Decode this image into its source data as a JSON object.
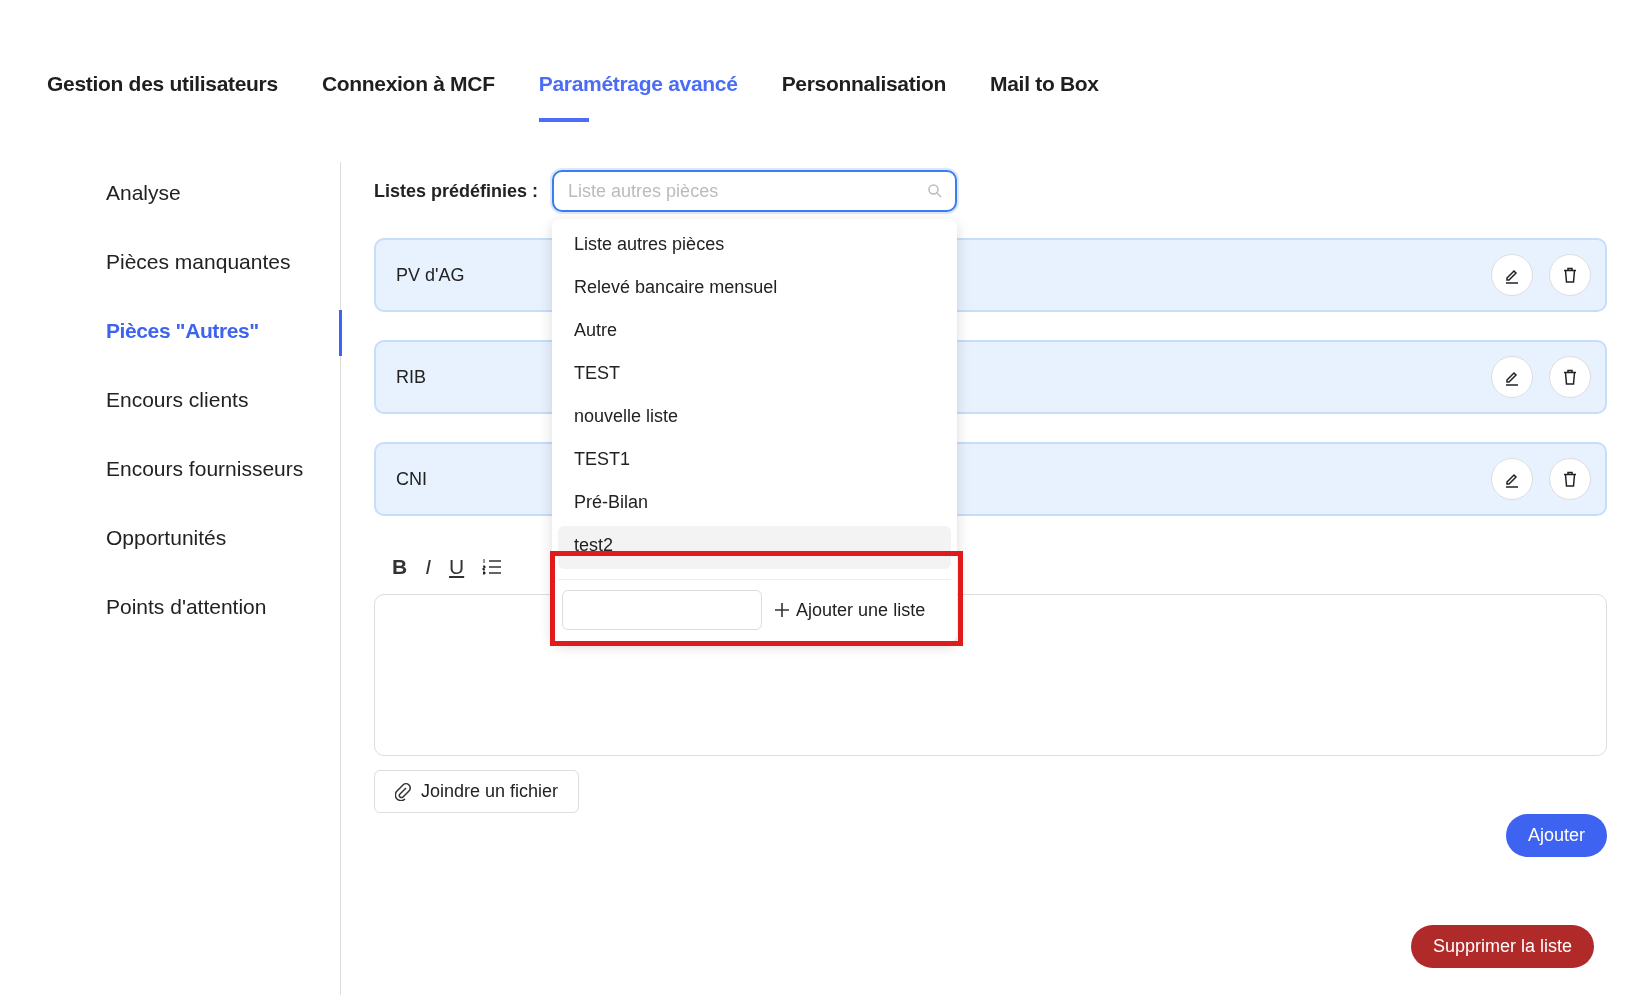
{
  "tabs": [
    {
      "label": "Gestion des utilisateurs",
      "selected": false
    },
    {
      "label": "Connexion à MCF",
      "selected": false
    },
    {
      "label": "Paramétrage avancé",
      "selected": true
    },
    {
      "label": "Personnalisation",
      "selected": false
    },
    {
      "label": "Mail to Box",
      "selected": false
    }
  ],
  "sidebar": {
    "items": [
      {
        "label": "Analyse",
        "selected": false
      },
      {
        "label": "Pièces manquantes",
        "selected": false
      },
      {
        "label": "Pièces \"Autres\"",
        "selected": true
      },
      {
        "label": "Encours clients",
        "selected": false
      },
      {
        "label": "Encours fournisseurs",
        "selected": false
      },
      {
        "label": "Opportunités",
        "selected": false
      },
      {
        "label": "Points d'attention",
        "selected": false
      }
    ]
  },
  "predefined_lists": {
    "label": "Listes prédéfinies :",
    "placeholder": "Liste autres pièces",
    "options": [
      {
        "label": "Liste autres pièces",
        "highlighted": false
      },
      {
        "label": "Relevé bancaire mensuel",
        "highlighted": false
      },
      {
        "label": "Autre",
        "highlighted": false
      },
      {
        "label": "TEST",
        "highlighted": false
      },
      {
        "label": "nouvelle liste",
        "highlighted": false
      },
      {
        "label": "TEST1",
        "highlighted": false
      },
      {
        "label": "Pré-Bilan",
        "highlighted": false
      },
      {
        "label": "test2",
        "highlighted": true
      }
    ],
    "add_button": "Ajouter une liste"
  },
  "items": [
    {
      "label": "PV d'AG"
    },
    {
      "label": "RIB"
    },
    {
      "label": "CNI"
    }
  ],
  "toolbar": [
    {
      "kind": "bold",
      "label": "B"
    },
    {
      "kind": "italic",
      "label": "I"
    },
    {
      "kind": "underline",
      "label": "U"
    }
  ],
  "attach_button": "Joindre un fichier",
  "add_button": "Ajouter",
  "delete_list_button": "Supprimer la liste"
}
